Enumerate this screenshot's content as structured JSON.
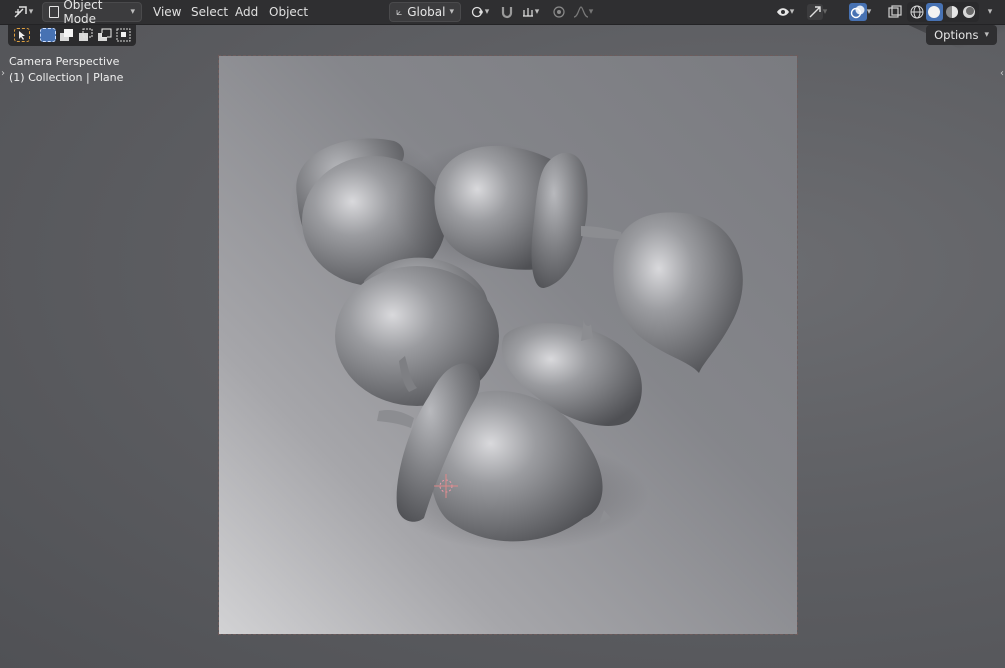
{
  "header": {
    "editor_type_icon": "transform-gizmo-icon",
    "mode": {
      "label": "Object Mode",
      "icon": "object-mode-icon"
    },
    "menus": [
      {
        "label": "View"
      },
      {
        "label": "Select"
      },
      {
        "label": "Add"
      },
      {
        "label": "Object"
      }
    ],
    "transform_orientation": {
      "label": "Global",
      "icon": "orientation-icon"
    },
    "pivot_icon": "pivot-point-icon",
    "snap_icon": "magnet-icon",
    "snap_target_icon": "snap-increment-icon",
    "proportional_icon": "proportional-edit-icon",
    "falloff_icon": "falloff-curve-icon",
    "visibility_icon": "eye-icon",
    "gizmo_icon": "gizmo-icon",
    "overlay_icon": "overlay-icon",
    "xray_icon": "xray-icon",
    "shading_modes": [
      "wireframe-icon",
      "solid-icon",
      "material-preview-icon",
      "rendered-icon"
    ],
    "active_shading": "solid-icon",
    "accent_color": "#4772b3"
  },
  "toolbar": {
    "select_tool_icon": "select-box-icon",
    "select_modes": [
      "set-icon",
      "extend-icon",
      "subtract-icon",
      "difference-icon",
      "intersect-icon"
    ]
  },
  "viewport": {
    "view_name": "Camera Perspective",
    "collection_info": "(1) Collection | Plane",
    "options_label": "Options"
  }
}
